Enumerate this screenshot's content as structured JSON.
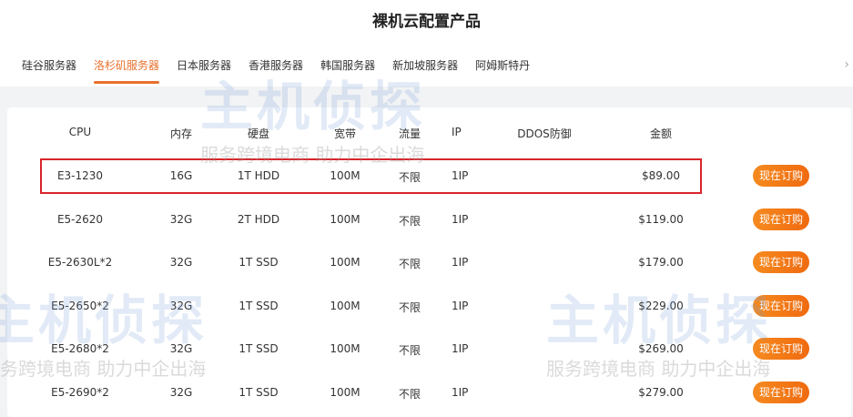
{
  "page_title": "裸机云配置产品",
  "tabs": [
    "硅谷服务器",
    "洛杉矶服务器",
    "日本服务器",
    "香港服务器",
    "韩国服务器",
    "新加坡服务器",
    "阿姆斯特丹"
  ],
  "active_tab": 1,
  "headers": {
    "cpu": "CPU",
    "ram": "内存",
    "disk": "硬盘",
    "bandwidth": "宽带",
    "traffic": "流量",
    "ip": "IP",
    "ddos": "DDOS防御",
    "price": "金额"
  },
  "rows": [
    {
      "cpu": "E3-1230",
      "ram": "16G",
      "disk": "1T HDD",
      "bandwidth": "100M",
      "traffic": "不限",
      "ip": "1IP",
      "ddos": "",
      "price": "$89.00",
      "button": "现在订购"
    },
    {
      "cpu": "E5-2620",
      "ram": "32G",
      "disk": "2T HDD",
      "bandwidth": "100M",
      "traffic": "不限",
      "ip": "1IP",
      "ddos": "",
      "price": "$119.00",
      "button": "现在订购"
    },
    {
      "cpu": "E5-2630L*2",
      "ram": "32G",
      "disk": "1T SSD",
      "bandwidth": "100M",
      "traffic": "不限",
      "ip": "1IP",
      "ddos": "",
      "price": "$179.00",
      "button": "现在订购"
    },
    {
      "cpu": "E5-2650*2",
      "ram": "32G",
      "disk": "1T SSD",
      "bandwidth": "100M",
      "traffic": "不限",
      "ip": "1IP",
      "ddos": "",
      "price": "$229.00",
      "button": "现在订购"
    },
    {
      "cpu": "E5-2680*2",
      "ram": "32G",
      "disk": "1T SSD",
      "bandwidth": "100M",
      "traffic": "不限",
      "ip": "1IP",
      "ddos": "",
      "price": "$269.00",
      "button": "现在订购"
    },
    {
      "cpu": "E5-2690*2",
      "ram": "32G",
      "disk": "1T SSD",
      "bandwidth": "100M",
      "traffic": "不限",
      "ip": "1IP",
      "ddos": "",
      "price": "$279.00",
      "button": "现在订购"
    }
  ],
  "watermark": {
    "brand": "主机侦探",
    "slogan": "服务跨境电商 助力中企出海"
  },
  "colors": {
    "accent": "#e8712c",
    "highlight": "#d9252b"
  }
}
